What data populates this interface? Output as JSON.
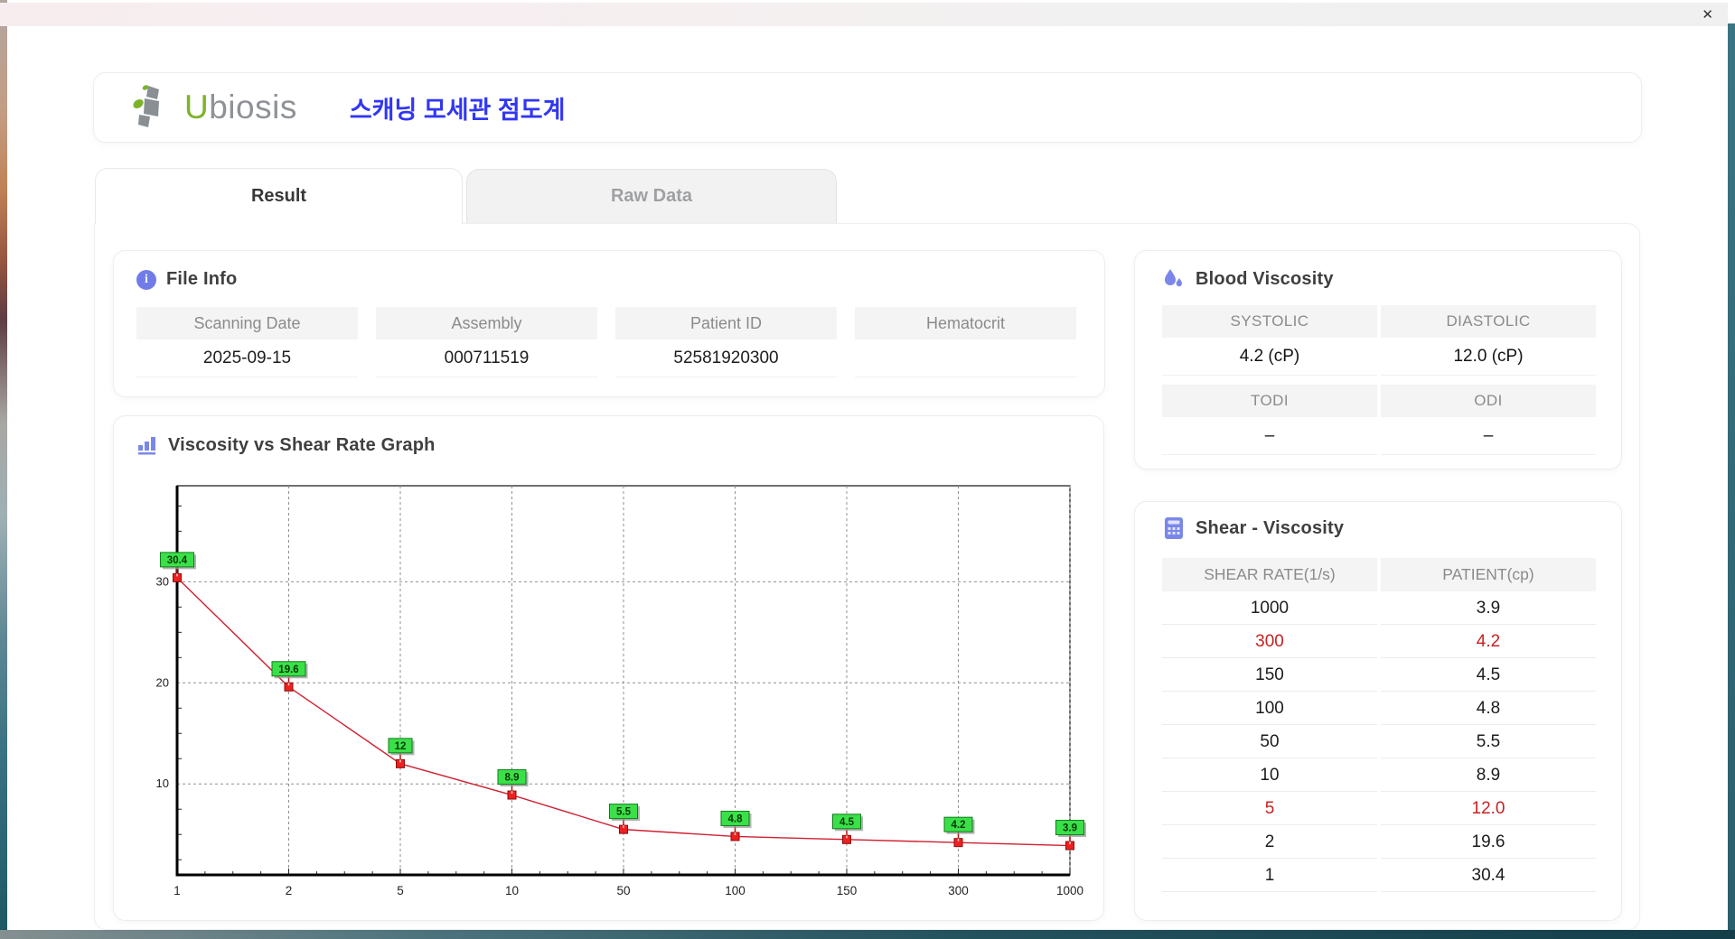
{
  "window": {
    "close_glyph": "✕"
  },
  "header": {
    "logo_first_letter": "U",
    "logo_rest": "biosis",
    "app_title": "스캐닝 모세관 점도계"
  },
  "tabs": [
    {
      "label": "Result",
      "active": true
    },
    {
      "label": "Raw Data",
      "active": false
    }
  ],
  "file_info": {
    "title": "File Info",
    "fields": [
      {
        "label": "Scanning Date",
        "value": "2025-09-15"
      },
      {
        "label": "Assembly",
        "value": "000711519"
      },
      {
        "label": "Patient ID",
        "value": "52581920300"
      },
      {
        "label": "Hematocrit",
        "value": ""
      }
    ]
  },
  "blood_viscosity": {
    "title": "Blood Viscosity",
    "groups": [
      {
        "cells": [
          {
            "label": "SYSTOLIC",
            "value": "4.2 (cP)"
          },
          {
            "label": "DIASTOLIC",
            "value": "12.0 (cP)"
          }
        ]
      },
      {
        "cells": [
          {
            "label": "TODI",
            "value": "–"
          },
          {
            "label": "ODI",
            "value": "–"
          }
        ]
      }
    ]
  },
  "graph": {
    "title": "Viscosity vs Shear Rate Graph"
  },
  "chart_data": {
    "type": "line",
    "title": "Viscosity vs Shear Rate Graph",
    "x": [
      1,
      2,
      5,
      10,
      50,
      100,
      150,
      300,
      1000
    ],
    "values": [
      30.4,
      19.6,
      12,
      8.9,
      5.5,
      4.8,
      4.5,
      4.2,
      3.9
    ],
    "point_labels": [
      "30.4",
      "19.6",
      "12",
      "8.9",
      "5.5",
      "4.8",
      "4.5",
      "4.2",
      "3.9"
    ],
    "x_axis_type": "category-log-labels",
    "xlabel": "",
    "ylabel": "",
    "yticks": [
      10,
      20,
      30
    ],
    "ylim": [
      1,
      39.5
    ],
    "grid": true,
    "legend": false,
    "line_color": "#cf2030",
    "marker_color": "#ef1f1f",
    "marker_border": "#8c0d0d",
    "label_bg": "#3be049",
    "label_border": "#0f7d18",
    "grid_color": "#909090"
  },
  "shear_table": {
    "title": "Shear - Viscosity",
    "columns": [
      "SHEAR RATE(1/s)",
      "PATIENT(cp)"
    ],
    "rows": [
      {
        "shear": "1000",
        "patient": "3.9",
        "highlight": false
      },
      {
        "shear": "300",
        "patient": "4.2",
        "highlight": true
      },
      {
        "shear": "150",
        "patient": "4.5",
        "highlight": false
      },
      {
        "shear": "100",
        "patient": "4.8",
        "highlight": false
      },
      {
        "shear": "50",
        "patient": "5.5",
        "highlight": false
      },
      {
        "shear": "10",
        "patient": "8.9",
        "highlight": false
      },
      {
        "shear": "5",
        "patient": "12.0",
        "highlight": true
      },
      {
        "shear": "2",
        "patient": "19.6",
        "highlight": false
      },
      {
        "shear": "1",
        "patient": "30.4",
        "highlight": false
      }
    ]
  },
  "colors": {
    "accent_blue": "#3137f2",
    "accent_indigo": "#7b87e8",
    "logo_green": "#7db32a",
    "logo_gray": "#8f9296",
    "alert_red": "#c62222",
    "table_header_bg": "#f4f4f5"
  }
}
